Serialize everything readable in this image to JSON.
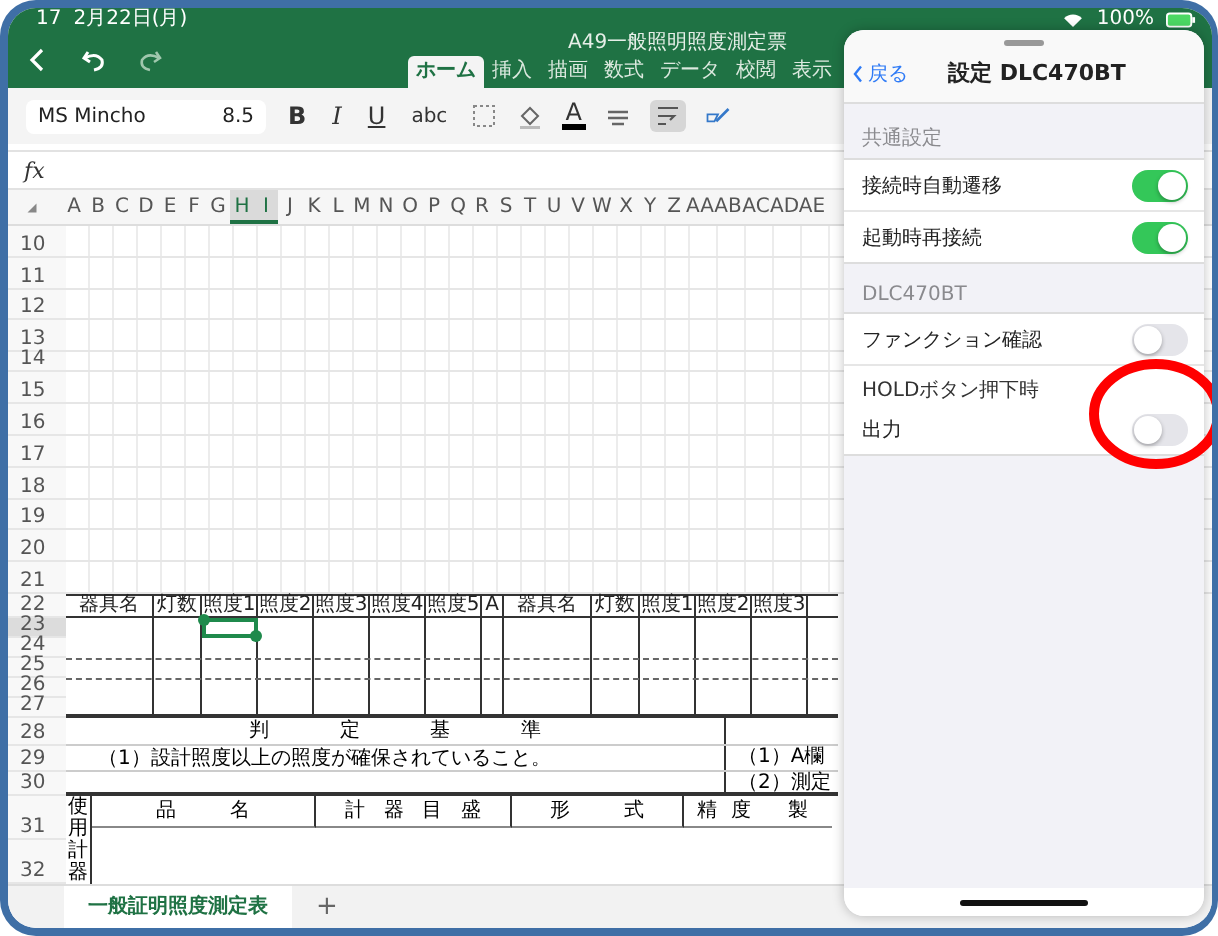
{
  "status_bar": {
    "time": "17",
    "date": "2月22日(月)",
    "battery": "100%"
  },
  "toolbar": {
    "title": "A49一般照明照度測定票",
    "tabs": [
      {
        "label": "ホーム",
        "selected": true
      },
      {
        "label": "挿入",
        "selected": false
      },
      {
        "label": "描画",
        "selected": false
      },
      {
        "label": "数式",
        "selected": false
      },
      {
        "label": "データ",
        "selected": false
      },
      {
        "label": "校閲",
        "selected": false
      },
      {
        "label": "表示",
        "selected": false
      }
    ]
  },
  "format_bar": {
    "font": "MS Mincho",
    "size": "8.5",
    "bold": "B",
    "italic": "I",
    "underline": "U",
    "strike": "abc",
    "font_color": "A"
  },
  "formula_bar": {
    "label": "fx"
  },
  "columns": [
    {
      "label": "A",
      "selected": false
    },
    {
      "label": "B",
      "selected": false
    },
    {
      "label": "C",
      "selected": false
    },
    {
      "label": "D",
      "selected": false
    },
    {
      "label": "E",
      "selected": false
    },
    {
      "label": "F",
      "selected": false
    },
    {
      "label": "G",
      "selected": false
    },
    {
      "label": "H",
      "selected": true
    },
    {
      "label": "I",
      "selected": true
    },
    {
      "label": "J",
      "selected": false
    },
    {
      "label": "K",
      "selected": false
    },
    {
      "label": "L",
      "selected": false
    },
    {
      "label": "M",
      "selected": false
    },
    {
      "label": "N",
      "selected": false
    },
    {
      "label": "O",
      "selected": false
    },
    {
      "label": "P",
      "selected": false
    },
    {
      "label": "Q",
      "selected": false
    },
    {
      "label": "R",
      "selected": false
    },
    {
      "label": "S",
      "selected": false
    },
    {
      "label": "T",
      "selected": false
    },
    {
      "label": "U",
      "selected": false
    },
    {
      "label": "V",
      "selected": false
    },
    {
      "label": "W",
      "selected": false
    },
    {
      "label": "X",
      "selected": false
    },
    {
      "label": "Y",
      "selected": false
    },
    {
      "label": "Z",
      "selected": false
    },
    {
      "label": "AA",
      "selected": false
    },
    {
      "label": "AB",
      "selected": false
    },
    {
      "label": "AC",
      "selected": false
    },
    {
      "label": "AD",
      "selected": false
    },
    {
      "label": "AE",
      "selected": false
    }
  ],
  "row_numbers": [
    "10",
    "11",
    "12",
    "13",
    "14",
    "15",
    "16",
    "17",
    "18",
    "19",
    "20",
    "21"
  ],
  "form": {
    "row_numbers": [
      {
        "label": "22",
        "selected": false
      },
      {
        "label": "23",
        "selected": true
      },
      {
        "label": "24",
        "selected": false
      },
      {
        "label": "25",
        "selected": false
      },
      {
        "label": "26",
        "selected": false
      },
      {
        "label": "27",
        "selected": false
      },
      {
        "label": "28",
        "selected": false
      },
      {
        "label": "29",
        "selected": false
      },
      {
        "label": "30",
        "selected": false
      },
      {
        "label": "31",
        "selected": false
      },
      {
        "label": "32",
        "selected": false
      }
    ],
    "header_cells": [
      "器具名",
      "灯数",
      "照度1",
      "照度2",
      "照度3",
      "照度4",
      "照度5",
      "A",
      "器具名",
      "灯数",
      "照度1",
      "照度2",
      "照度3"
    ],
    "criteria_title": "判 定 基 準",
    "criteria_line": "（1）設計照度以上の照度が確保されていること。",
    "right_notes": [
      "（1）A欄",
      "（2）測定"
    ],
    "instrument_label": "使用計器",
    "instrument_columns": [
      "品 名",
      "計 器 目 盛",
      "形 式",
      "精 度",
      "製"
    ]
  },
  "sheet_tabs": [
    {
      "label": "一般証明照度測定表",
      "selected": true
    }
  ],
  "add_sheet": "+",
  "settings": {
    "back": "戻る",
    "title": "設定 DLC470BT",
    "sections": [
      {
        "header": "共通設定",
        "rows": [
          {
            "label": "接続時自動遷移",
            "on": true
          },
          {
            "label": "起動時再接続",
            "on": true
          }
        ]
      },
      {
        "header": "DLC470BT",
        "rows": [
          {
            "label": "ファンクション確認",
            "on": false
          },
          {
            "caption": "HOLDボタン押下時",
            "label": "出力",
            "on": false
          }
        ]
      }
    ]
  },
  "annotation": {
    "kind": "circle"
  }
}
